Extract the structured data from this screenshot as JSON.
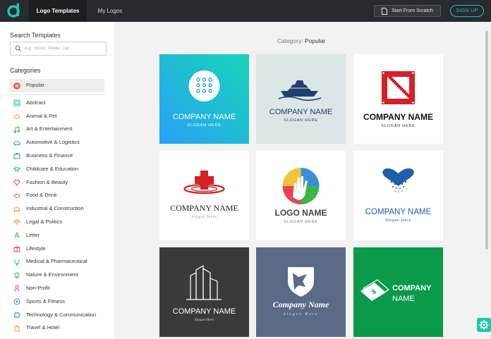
{
  "topbar": {
    "tabs": [
      {
        "label": "Logo Templates"
      },
      {
        "label": "My Logos"
      }
    ],
    "start_scratch_label": "Start From Scratch",
    "signup_label": "SIGN UP"
  },
  "sidebar": {
    "search_title": "Search Templates",
    "search_placeholder": "e.g. music, flower, car...",
    "categories_title": "Categories",
    "categories": [
      {
        "label": "Popular",
        "icon": "star-icon"
      },
      {
        "label": "Abstract",
        "icon": "abstract-icon"
      },
      {
        "label": "Animal & Pet",
        "icon": "paw-icon"
      },
      {
        "label": "Art & Entertainment",
        "icon": "music-note-icon"
      },
      {
        "label": "Automotive & Logistics",
        "icon": "car-icon"
      },
      {
        "label": "Business & Finance",
        "icon": "briefcase-icon"
      },
      {
        "label": "Childcare & Education",
        "icon": "graduation-cap-icon"
      },
      {
        "label": "Fashion & Beauty",
        "icon": "diamond-icon"
      },
      {
        "label": "Food & Drink",
        "icon": "food-icon"
      },
      {
        "label": "Industrial & Construction",
        "icon": "hard-hat-icon"
      },
      {
        "label": "Legal & Politics",
        "icon": "scales-icon"
      },
      {
        "label": "Letter",
        "icon": "letter-a-icon"
      },
      {
        "label": "Lifestyle",
        "icon": "gift-icon"
      },
      {
        "label": "Medical & Pharmaceutical",
        "icon": "stethoscope-icon"
      },
      {
        "label": "Nature & Environment",
        "icon": "leaf-icon"
      },
      {
        "label": "Non-Profit",
        "icon": "ribbon-icon"
      },
      {
        "label": "Sports & Fitness",
        "icon": "ball-icon"
      },
      {
        "label": "Technology & Communication",
        "icon": "chip-icon"
      },
      {
        "label": "Travel & Hotel",
        "icon": "luggage-icon"
      }
    ]
  },
  "main": {
    "category_prefix": "Category:",
    "category_name": "Popular",
    "cards": [
      {
        "company": "COMPANY NAME",
        "slogan": "SLOGAN HERE"
      },
      {
        "company": "COMPANY NAME",
        "slogan": "SLOGAN HERE"
      },
      {
        "company": "COMPANY NAME",
        "slogan": "SLOGAN HERE"
      },
      {
        "company": "COMPANY NAME",
        "slogan": "Slogan Here"
      },
      {
        "company": "LOGO NAME",
        "slogan": "SLOGAN HERE"
      },
      {
        "company": "COMPANY NAME",
        "slogan": "Slogan Here"
      },
      {
        "company": "COMPANY NAME",
        "slogan": "Slogan Here"
      },
      {
        "company": "Company Name",
        "slogan": "Slogan Here"
      },
      {
        "company": "COMPANY",
        "company2": "NAME"
      }
    ]
  },
  "colors": {
    "accent": "#21c4b4",
    "topbar": "#272a2e",
    "popular_icon": "#f15a3a"
  }
}
